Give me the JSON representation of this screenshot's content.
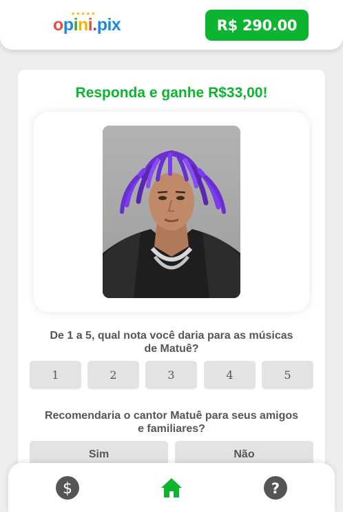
{
  "header": {
    "logo_text": "opini.pix",
    "balance_label": "R$ 290.00"
  },
  "card": {
    "title": "Responda e ganhe R$33,00!",
    "photo_icon": "person-portrait-photo",
    "question_1": "De 1 a 5, qual nota você daria para as músicas de Matuê?",
    "rating_options": [
      "1",
      "2",
      "3",
      "4",
      "5"
    ],
    "question_2": "Recomendaria o cantor Matuê para seus amigos e familiares?",
    "yes_label": "Sim",
    "no_label": "Não"
  },
  "bottom_nav": {
    "items": [
      {
        "icon": "dollar-icon",
        "color": "#555555"
      },
      {
        "icon": "home-icon",
        "color": "#0db430"
      },
      {
        "icon": "help-icon",
        "color": "#555555"
      }
    ]
  },
  "colors": {
    "accent": "#0db430",
    "button_bg": "#e3e3e3",
    "text": "#555555"
  }
}
